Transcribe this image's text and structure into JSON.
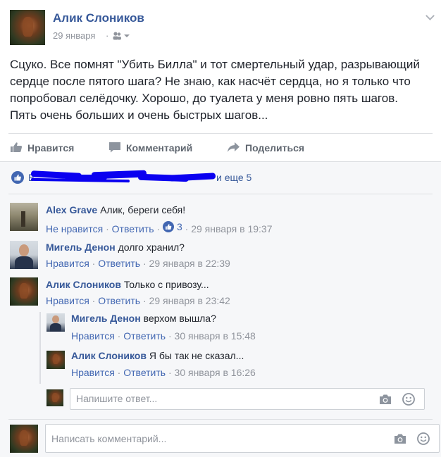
{
  "post": {
    "author": "Алик Слоников",
    "date": "29 января",
    "text_lines": [
      "Сцуко. Все помнят \"Убить Билла\" и тот смертельный удар, разрывающий",
      "сердце после пятого шага? Не знаю, как насчёт сердца, но я только что",
      "попробовал селёдочку. Хорошо, до туалета у меня ровно пять шагов.",
      "Пять очень больших и очень быстрых шагов..."
    ]
  },
  "actions": {
    "like": "Нравится",
    "comment": "Комментарий",
    "share": "Поделиться"
  },
  "reactions": {
    "visible_prefix": "Б",
    "suffix": "и еще 5"
  },
  "comments": [
    {
      "author": "Alex Grave",
      "text": "Алик, береги себя!",
      "like_label": "Не нравится",
      "reply_label": "Ответить",
      "like_count": "3",
      "timestamp": "29 января в 19:37"
    },
    {
      "author": "Мигель Денон",
      "text": "долго хранил?",
      "like_label": "Нравится",
      "reply_label": "Ответить",
      "timestamp": "29 января в 22:39"
    },
    {
      "author": "Алик Слоников",
      "text": "Только с привозу...",
      "like_label": "Нравится",
      "reply_label": "Ответить",
      "timestamp": "29 января в 23:42",
      "replies": [
        {
          "author": "Мигель Денон",
          "text": "верхом вышла?",
          "like_label": "Нравится",
          "reply_label": "Ответить",
          "timestamp": "30 января в 15:48"
        },
        {
          "author": "Алик Слоников",
          "text": "Я бы так не сказал...",
          "like_label": "Нравится",
          "reply_label": "Ответить",
          "timestamp": "30 января в 16:26"
        }
      ]
    }
  ],
  "reply_input": {
    "placeholder": "Напишите ответ..."
  },
  "comment_input": {
    "placeholder": "Написать комментарий..."
  },
  "separator": "·",
  "colors": {
    "link": "#365899",
    "like_blue": "#4267b2",
    "muted": "#90949c",
    "redaction": "#0a00f0"
  },
  "icons": [
    "post-options-chevron-icon",
    "friends-audience-icon",
    "thumbs-up-icon",
    "comment-bubble-icon",
    "share-arrow-icon",
    "like-reaction-icon",
    "camera-icon",
    "smiley-icon"
  ]
}
